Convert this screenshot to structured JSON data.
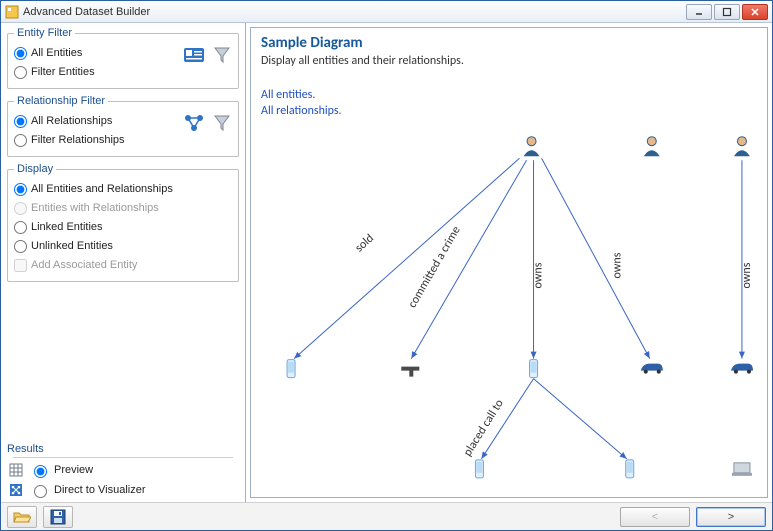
{
  "window": {
    "title": "Advanced Dataset Builder"
  },
  "entityFilter": {
    "legend": "Entity Filter",
    "opt_all": "All Entities",
    "opt_filter": "Filter Entities"
  },
  "relFilter": {
    "legend": "Relationship Filter",
    "opt_all": "All Relationships",
    "opt_filter": "Filter Relationships"
  },
  "display": {
    "legend": "Display",
    "opt_all": "All Entities and Relationships",
    "opt_withrel": "Entities with Relationships",
    "opt_linked": "Linked Entities",
    "opt_unlinked": "Unlinked Entities",
    "chk_assoc": "Add Associated Entity"
  },
  "results": {
    "legend": "Results",
    "opt_preview": "Preview",
    "opt_direct": "Direct to Visualizer"
  },
  "diagram": {
    "title": "Sample Diagram",
    "subtitle": "Display all entities and their relationships.",
    "line1": "All entities.",
    "line2": "All relationships.",
    "edges": {
      "sold": "sold",
      "crime": "committed a crime",
      "owns1": "owns",
      "owns2": "owns",
      "owns3": "owns",
      "call": "placed call to"
    }
  },
  "footer": {
    "back": "<",
    "next": ">"
  }
}
